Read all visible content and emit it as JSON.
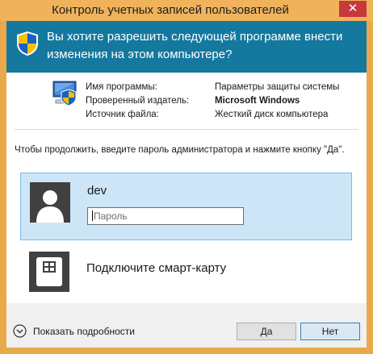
{
  "window": {
    "title": "Контроль учетных записей пользователей",
    "close_label": "✕"
  },
  "banner": {
    "question": "Вы хотите разрешить следующей программе внести изменения на этом компьютере?"
  },
  "program_info": {
    "name_label": "Имя программы:",
    "name_value": "Параметры защиты системы",
    "publisher_label": "Проверенный издатель:",
    "publisher_value": "Microsoft Windows",
    "source_label": "Источник файла:",
    "source_value": "Жесткий диск компьютера"
  },
  "prompt": "Чтобы продолжить, введите пароль администратора и нажмите кнопку \"Да\".",
  "user": {
    "name": "dev",
    "password_placeholder": "Пароль",
    "password_value": ""
  },
  "smartcard": {
    "label": "Подключите смарт-карту"
  },
  "footer": {
    "details_label": "Показать подробности",
    "yes_label": "Да",
    "no_label": "Нет"
  },
  "colors": {
    "banner": "#14789f",
    "title_bar": "#f0b35c",
    "selected_tile": "#cde6f7",
    "close_button": "#c7383a"
  }
}
